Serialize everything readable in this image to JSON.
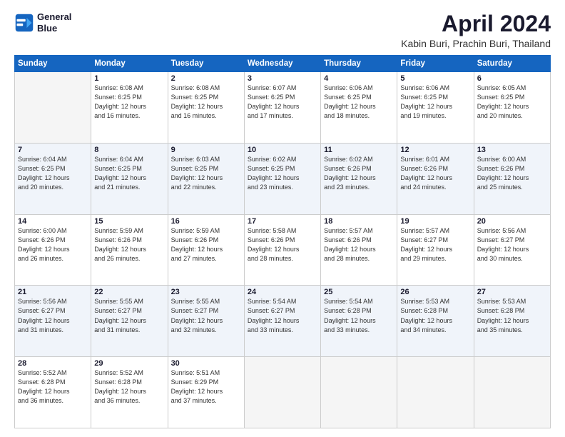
{
  "header": {
    "logo_line1": "General",
    "logo_line2": "Blue",
    "title": "April 2024",
    "subtitle": "Kabin Buri, Prachin Buri, Thailand"
  },
  "weekdays": [
    "Sunday",
    "Monday",
    "Tuesday",
    "Wednesday",
    "Thursday",
    "Friday",
    "Saturday"
  ],
  "weeks": [
    [
      {
        "day": "",
        "info": ""
      },
      {
        "day": "1",
        "info": "Sunrise: 6:08 AM\nSunset: 6:25 PM\nDaylight: 12 hours\nand 16 minutes."
      },
      {
        "day": "2",
        "info": "Sunrise: 6:08 AM\nSunset: 6:25 PM\nDaylight: 12 hours\nand 16 minutes."
      },
      {
        "day": "3",
        "info": "Sunrise: 6:07 AM\nSunset: 6:25 PM\nDaylight: 12 hours\nand 17 minutes."
      },
      {
        "day": "4",
        "info": "Sunrise: 6:06 AM\nSunset: 6:25 PM\nDaylight: 12 hours\nand 18 minutes."
      },
      {
        "day": "5",
        "info": "Sunrise: 6:06 AM\nSunset: 6:25 PM\nDaylight: 12 hours\nand 19 minutes."
      },
      {
        "day": "6",
        "info": "Sunrise: 6:05 AM\nSunset: 6:25 PM\nDaylight: 12 hours\nand 20 minutes."
      }
    ],
    [
      {
        "day": "7",
        "info": "Sunrise: 6:04 AM\nSunset: 6:25 PM\nDaylight: 12 hours\nand 20 minutes."
      },
      {
        "day": "8",
        "info": "Sunrise: 6:04 AM\nSunset: 6:25 PM\nDaylight: 12 hours\nand 21 minutes."
      },
      {
        "day": "9",
        "info": "Sunrise: 6:03 AM\nSunset: 6:25 PM\nDaylight: 12 hours\nand 22 minutes."
      },
      {
        "day": "10",
        "info": "Sunrise: 6:02 AM\nSunset: 6:25 PM\nDaylight: 12 hours\nand 23 minutes."
      },
      {
        "day": "11",
        "info": "Sunrise: 6:02 AM\nSunset: 6:26 PM\nDaylight: 12 hours\nand 23 minutes."
      },
      {
        "day": "12",
        "info": "Sunrise: 6:01 AM\nSunset: 6:26 PM\nDaylight: 12 hours\nand 24 minutes."
      },
      {
        "day": "13",
        "info": "Sunrise: 6:00 AM\nSunset: 6:26 PM\nDaylight: 12 hours\nand 25 minutes."
      }
    ],
    [
      {
        "day": "14",
        "info": "Sunrise: 6:00 AM\nSunset: 6:26 PM\nDaylight: 12 hours\nand 26 minutes."
      },
      {
        "day": "15",
        "info": "Sunrise: 5:59 AM\nSunset: 6:26 PM\nDaylight: 12 hours\nand 26 minutes."
      },
      {
        "day": "16",
        "info": "Sunrise: 5:59 AM\nSunset: 6:26 PM\nDaylight: 12 hours\nand 27 minutes."
      },
      {
        "day": "17",
        "info": "Sunrise: 5:58 AM\nSunset: 6:26 PM\nDaylight: 12 hours\nand 28 minutes."
      },
      {
        "day": "18",
        "info": "Sunrise: 5:57 AM\nSunset: 6:26 PM\nDaylight: 12 hours\nand 28 minutes."
      },
      {
        "day": "19",
        "info": "Sunrise: 5:57 AM\nSunset: 6:27 PM\nDaylight: 12 hours\nand 29 minutes."
      },
      {
        "day": "20",
        "info": "Sunrise: 5:56 AM\nSunset: 6:27 PM\nDaylight: 12 hours\nand 30 minutes."
      }
    ],
    [
      {
        "day": "21",
        "info": "Sunrise: 5:56 AM\nSunset: 6:27 PM\nDaylight: 12 hours\nand 31 minutes."
      },
      {
        "day": "22",
        "info": "Sunrise: 5:55 AM\nSunset: 6:27 PM\nDaylight: 12 hours\nand 31 minutes."
      },
      {
        "day": "23",
        "info": "Sunrise: 5:55 AM\nSunset: 6:27 PM\nDaylight: 12 hours\nand 32 minutes."
      },
      {
        "day": "24",
        "info": "Sunrise: 5:54 AM\nSunset: 6:27 PM\nDaylight: 12 hours\nand 33 minutes."
      },
      {
        "day": "25",
        "info": "Sunrise: 5:54 AM\nSunset: 6:28 PM\nDaylight: 12 hours\nand 33 minutes."
      },
      {
        "day": "26",
        "info": "Sunrise: 5:53 AM\nSunset: 6:28 PM\nDaylight: 12 hours\nand 34 minutes."
      },
      {
        "day": "27",
        "info": "Sunrise: 5:53 AM\nSunset: 6:28 PM\nDaylight: 12 hours\nand 35 minutes."
      }
    ],
    [
      {
        "day": "28",
        "info": "Sunrise: 5:52 AM\nSunset: 6:28 PM\nDaylight: 12 hours\nand 36 minutes."
      },
      {
        "day": "29",
        "info": "Sunrise: 5:52 AM\nSunset: 6:28 PM\nDaylight: 12 hours\nand 36 minutes."
      },
      {
        "day": "30",
        "info": "Sunrise: 5:51 AM\nSunset: 6:29 PM\nDaylight: 12 hours\nand 37 minutes."
      },
      {
        "day": "",
        "info": ""
      },
      {
        "day": "",
        "info": ""
      },
      {
        "day": "",
        "info": ""
      },
      {
        "day": "",
        "info": ""
      }
    ]
  ]
}
